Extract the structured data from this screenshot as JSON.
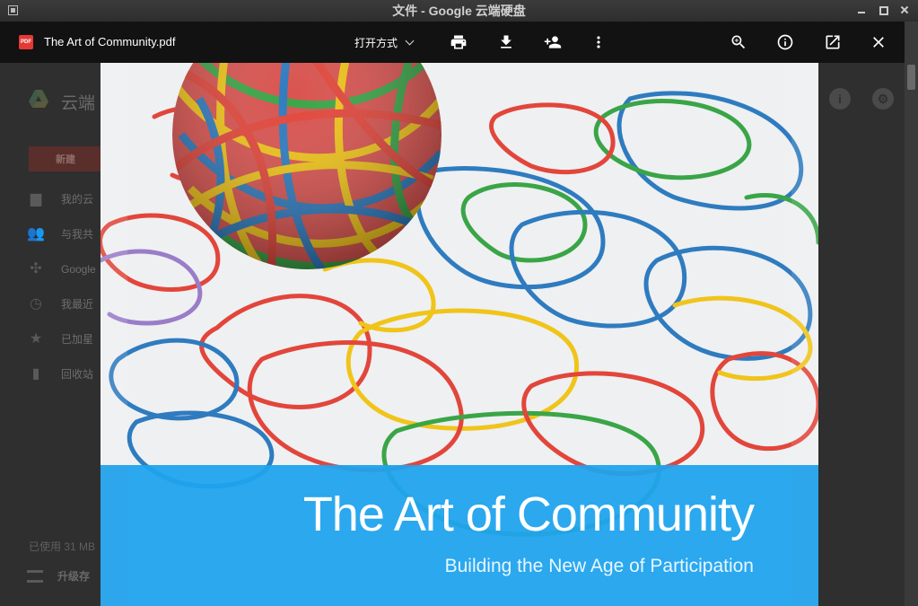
{
  "window": {
    "title": "文件 - Google 云端硬盘"
  },
  "drive": {
    "brand": "云端",
    "new_button": "新建",
    "nav": [
      {
        "label": "我的云",
        "icon": "folder-icon"
      },
      {
        "label": "与我共",
        "icon": "people-icon"
      },
      {
        "label": "Google",
        "icon": "photos-icon"
      },
      {
        "label": "我最近",
        "icon": "clock-icon"
      },
      {
        "label": "已加星",
        "icon": "star-icon"
      },
      {
        "label": "回收站",
        "icon": "trash-icon"
      }
    ],
    "storage": "已使用 31 MB",
    "upgrade": "升级存"
  },
  "viewer": {
    "file_name": "The Art of Community.pdf",
    "file_type_badge": "PDF",
    "open_with": "打开方式"
  },
  "document": {
    "title": "The Art of Community",
    "subtitle": "Building the New Age of Participation"
  },
  "colors": {
    "band": "#1ca0ec",
    "pdf_badge": "#e53935",
    "toolbar": "#101010"
  }
}
